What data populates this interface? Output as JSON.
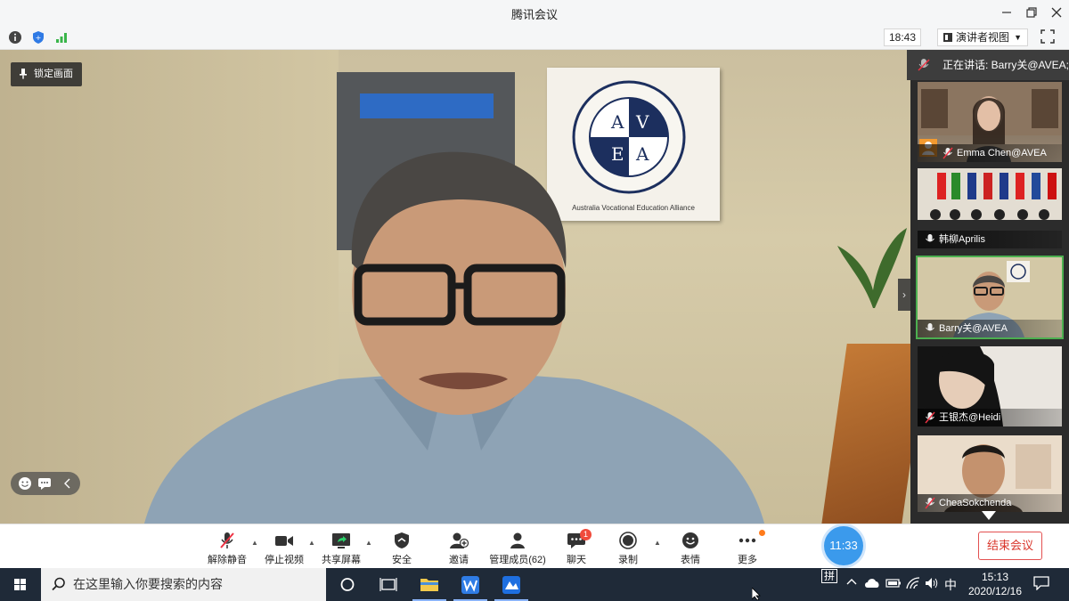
{
  "window": {
    "title": "腾讯会议"
  },
  "infobar": {
    "time": "18:43",
    "view_label": "演讲者视图"
  },
  "main": {
    "lock_label": "锁定画面",
    "sign_letters": [
      "A",
      "V",
      "E",
      "A"
    ],
    "sign_caption": "Australia Vocational Education Alliance"
  },
  "speaking": {
    "label": "正在讲话: Barry关@AVEA;"
  },
  "participants": [
    {
      "name": "Emma Chen@AVEA",
      "muted": true
    },
    {
      "name": "韩柳Aprilis",
      "muted": false
    },
    {
      "name": "Barry关@AVEA",
      "muted": false,
      "active": true
    },
    {
      "name": "王银杰@Heidi",
      "muted": true
    },
    {
      "name": "CheaSokchenda",
      "muted": true
    }
  ],
  "toolbar": {
    "unmute": "解除静音",
    "stop_video": "停止视频",
    "share_screen": "共享屏幕",
    "security": "安全",
    "invite": "邀请",
    "manage_members": "管理成员(62)",
    "chat": "聊天",
    "chat_badge": "1",
    "record": "录制",
    "reactions": "表情",
    "more": "更多",
    "timer": "11:33",
    "end_meeting": "结束会议"
  },
  "taskbar": {
    "search_placeholder": "在这里输入你要搜索的内容",
    "ime_mode": "拼",
    "ime_lang": "中",
    "clock_time": "15:13",
    "clock_date": "2020/12/16"
  },
  "colors": {
    "accent_blue": "#3b9aec",
    "end_red": "#d9362b",
    "active_green": "#4caf50",
    "taskbar": "#1f2a38"
  }
}
